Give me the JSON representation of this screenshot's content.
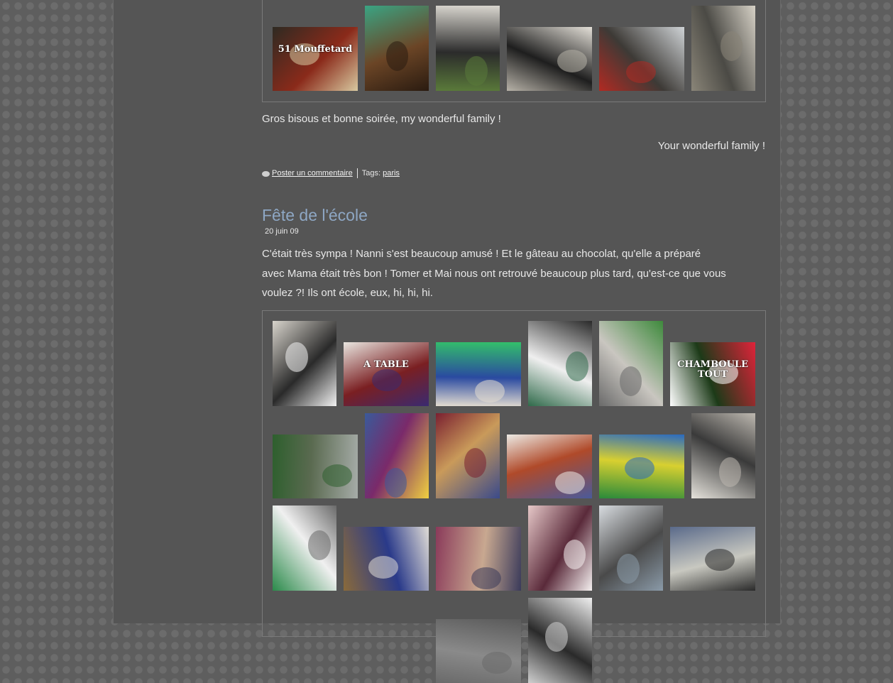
{
  "post1": {
    "closing_line": "Gros bisous et bonne soirée, my wonderful family !",
    "signature": "Your wonderful family !",
    "comment_link": "Poster un commentaire",
    "tags_label": "Tags:",
    "tag": "paris",
    "photos": [
      {
        "name": "photo-mouffetard-shop",
        "sign": "51 Mouffetard",
        "colors": [
          "#2e2a22",
          "#8a2a1a",
          "#d8c9a0"
        ]
      },
      {
        "name": "photo-wooden-door",
        "colors": [
          "#3aa483",
          "#6b4526",
          "#2a1b10"
        ]
      },
      {
        "name": "photo-woman-camera",
        "colors": [
          "#d9d6cf",
          "#2b2b2b",
          "#5a7a3a"
        ]
      },
      {
        "name": "photo-street-art-figures",
        "colors": [
          "#e4e0d8",
          "#1e1e1e",
          "#b7b2a8"
        ]
      },
      {
        "name": "photo-street-clock",
        "colors": [
          "#cfd3d6",
          "#3d3a36",
          "#b22a22"
        ]
      },
      {
        "name": "photo-old-building",
        "colors": [
          "#d6d1c6",
          "#4b4a45",
          "#8a8578"
        ]
      }
    ]
  },
  "post2": {
    "title": "Fête de l'école",
    "date": "20 juin 09",
    "body_line1": "C'était très sympa ! Nanni s'est beaucoup amusé ! Et le gâteau au chocolat, qu'elle a préparé",
    "body_line2": "avec Mama était très bon ! Tomer et Mai nous ont retrouvé beaucoup plus tard, qu'est-ce que vous",
    "body_line3": "voulez ?! Ils ont école, eux, hi, hi, hi.",
    "photos": [
      {
        "name": "photo-chef-hat-kid",
        "colors": [
          "#d8d4cc",
          "#2a2a2a",
          "#f2f2f2"
        ]
      },
      {
        "name": "photo-a-table-sign",
        "sign": "A TABLE",
        "colors": [
          "#e9e6e0",
          "#7a1f22",
          "#3a2a70"
        ]
      },
      {
        "name": "photo-kids-craft-table",
        "colors": [
          "#33c06a",
          "#2a4aa0",
          "#e3dcd0"
        ]
      },
      {
        "name": "photo-chef-boy",
        "colors": [
          "#2a2a2a",
          "#efefef",
          "#2f6a4a"
        ]
      },
      {
        "name": "photo-schoolyard-line",
        "colors": [
          "#3e8a3c",
          "#c9c6c0",
          "#6a6a6a"
        ]
      },
      {
        "name": "photo-chamboule-tout-sign",
        "sign": "CHAMBOULE TOUT",
        "colors": [
          "#e0233a",
          "#1c3a18",
          "#ffffff"
        ]
      },
      {
        "name": "photo-playground-games",
        "colors": [
          "#a6aca8",
          "#5a6a50",
          "#2d5f2d"
        ]
      },
      {
        "name": "photo-girl-decorations",
        "colors": [
          "#f0d040",
          "#7a2a6a",
          "#3a5a9a"
        ]
      },
      {
        "name": "photo-cake-plates",
        "colors": [
          "#3a4a8a",
          "#c99a5a",
          "#7a2030"
        ]
      },
      {
        "name": "photo-collage-artwork",
        "colors": [
          "#4a5a9a",
          "#b04a2a",
          "#eceae4"
        ]
      },
      {
        "name": "photo-painted-banner",
        "colors": [
          "#2a8a3a",
          "#d8d030",
          "#2a6ac0"
        ]
      },
      {
        "name": "photo-cow-drawing",
        "colors": [
          "#e6e3dc",
          "#3a3a3a",
          "#bdb8b0"
        ]
      },
      {
        "name": "photo-striped-tent-girl",
        "colors": [
          "#2a8a4a",
          "#f0f0f0",
          "#6a6a6a"
        ]
      },
      {
        "name": "photo-classroom-board",
        "colors": [
          "#8a6a3a",
          "#2a3a8a",
          "#e0dcd6"
        ]
      },
      {
        "name": "photo-girl-classroom",
        "colors": [
          "#8a3a5a",
          "#c8a890",
          "#3a3a5a"
        ]
      },
      {
        "name": "photo-boy-drawing-wall",
        "colors": [
          "#e6c8c8",
          "#5a2a3a",
          "#f5f0f0"
        ]
      },
      {
        "name": "photo-school-building",
        "colors": [
          "#d8dce0",
          "#4a4a4a",
          "#8a9aa8"
        ]
      },
      {
        "name": "photo-school-courtyard",
        "colors": [
          "#5a6a8a",
          "#c8c8c0",
          "#2a2a2a"
        ]
      },
      {
        "name": "photo-partial-row4-a",
        "colors": [
          "#5a5a5a",
          "#8a8a8a",
          "#6a6a6a"
        ]
      },
      {
        "name": "photo-partial-house-drawing",
        "colors": [
          "#f0f0f0",
          "#2a2a2a",
          "#cfcfcf"
        ]
      }
    ]
  }
}
